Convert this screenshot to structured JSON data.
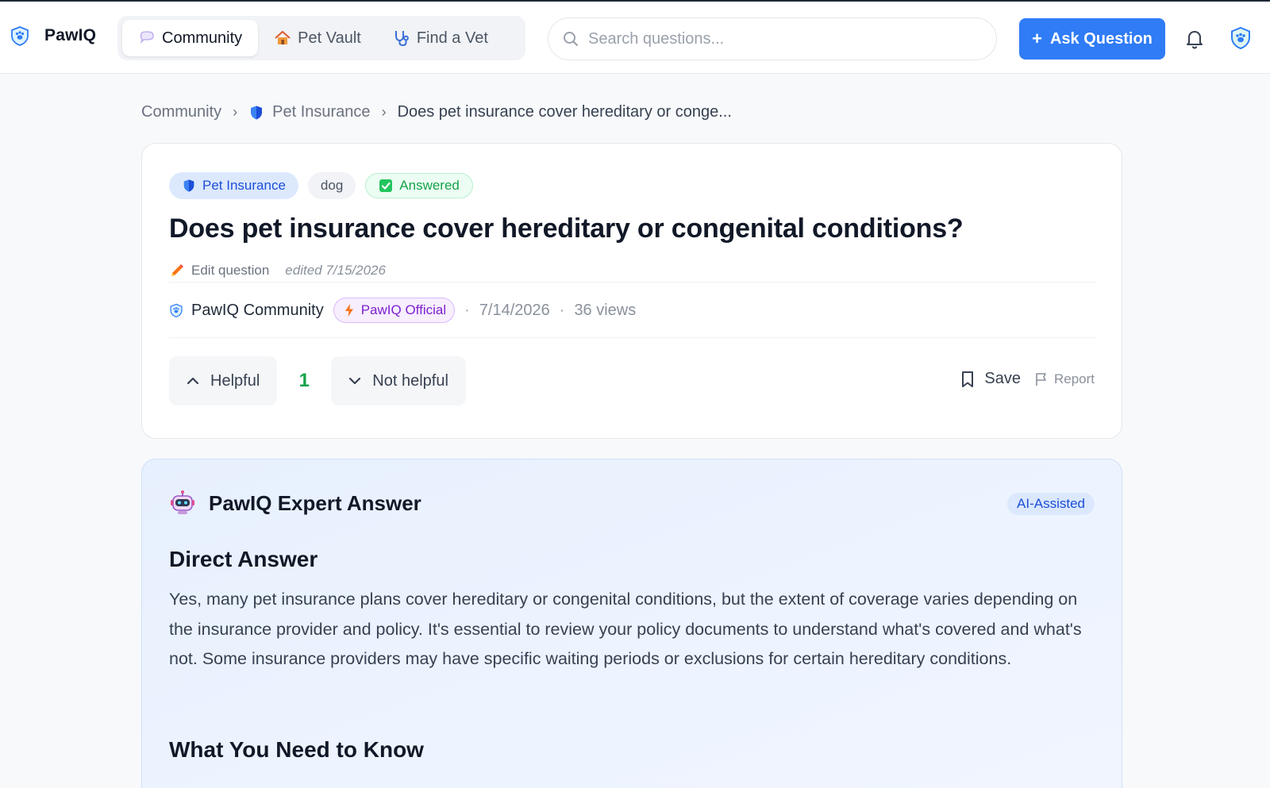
{
  "app": {
    "name": "PawIQ"
  },
  "nav": {
    "items": [
      {
        "label": "Community",
        "icon": "speech-bubble-icon",
        "active": true
      },
      {
        "label": "Pet Vault",
        "icon": "house-icon",
        "active": false
      },
      {
        "label": "Find a Vet",
        "icon": "stethoscope-icon",
        "active": false
      }
    ]
  },
  "search": {
    "placeholder": "Search questions..."
  },
  "header": {
    "ask_label": "Ask Question"
  },
  "breadcrumb": {
    "items": [
      "Community",
      "Pet Insurance",
      "Does pet insurance cover hereditary or conge..."
    ]
  },
  "question": {
    "tags": {
      "category": "Pet Insurance",
      "species": "dog",
      "status": "Answered"
    },
    "title": "Does pet insurance cover hereditary or congenital conditions?",
    "edit_label": "Edit question",
    "edited_text": "edited 7/15/2026",
    "author": "PawIQ Community",
    "author_badge": "PawIQ Official",
    "date": "7/14/2026",
    "views": "36 views",
    "helpful_label": "Helpful",
    "vote_count": "1",
    "not_helpful_label": "Not helpful",
    "save_label": "Save",
    "report_label": "Report"
  },
  "answer": {
    "title": "PawIQ Expert Answer",
    "badge": "AI-Assisted",
    "section1_heading": "Direct Answer",
    "section1_body": "Yes, many pet insurance plans cover hereditary or congenital conditions, but the extent of coverage varies depending on the insurance provider and policy. It's essential to review your policy documents to understand what's covered and what's not. Some insurance providers may have specific waiting periods or exclusions for certain hereditary conditions.",
    "section2_heading": "What You Need to Know"
  },
  "colors": {
    "accent": "#2f7cf6",
    "answered": "#16a34a",
    "official": "#7e22ce"
  }
}
